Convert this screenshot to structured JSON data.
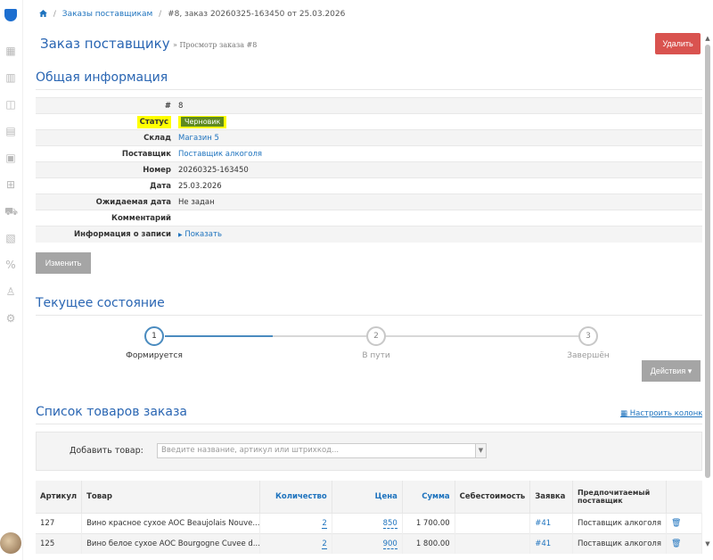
{
  "breadcrumb": {
    "parent": "Заказы поставщикам",
    "current": "#8, заказ 20260325-163450 от 25.03.2026"
  },
  "header": {
    "title": "Заказ поставщику",
    "subtitle": "» Просмотр заказа #8",
    "delete_label": "Удалить"
  },
  "general": {
    "title": "Общая информация",
    "rows": [
      {
        "label": "#",
        "value": "8"
      },
      {
        "label": "Статус",
        "value": "Черновик"
      },
      {
        "label": "Склад",
        "value": "Магазин 5"
      },
      {
        "label": "Поставщик",
        "value": "Поставщик алкоголя"
      },
      {
        "label": "Номер",
        "value": "20260325-163450"
      },
      {
        "label": "Дата",
        "value": "25.03.2026"
      },
      {
        "label": "Ожидаемая дата",
        "value": "Не задан"
      },
      {
        "label": "Комментарий",
        "value": ""
      },
      {
        "label": "Информация о записи",
        "value": "Показать"
      }
    ],
    "edit_label": "Изменить"
  },
  "state": {
    "title": "Текущее состояние",
    "steps": [
      {
        "num": "1",
        "label": "Формируется"
      },
      {
        "num": "2",
        "label": "В пути"
      },
      {
        "num": "3",
        "label": "Завершён"
      }
    ],
    "actions_label": "Действия ▾"
  },
  "items": {
    "title": "Список товаров заказа",
    "configure_label": "Настроить колонки",
    "add_label": "Добавить товар:",
    "add_placeholder": "Введите название, артикул или штрихкод...",
    "columns": [
      "Артикул",
      "Товар",
      "Количество",
      "Цена",
      "Сумма",
      "Себестоимость",
      "Заявка",
      "Предпочитаемый поставщик"
    ],
    "rows": [
      {
        "sku": "127",
        "name": "Вино красное сухое AOC Beaujolais Nouve...",
        "qty": "2",
        "price": "850",
        "sum": "1 700.00",
        "cost": "",
        "request": "#41",
        "supplier": "Поставщик алкоголя"
      },
      {
        "sku": "125",
        "name": "Вино белое сухое AOC Bourgogne Cuvee d...",
        "qty": "2",
        "price": "900",
        "sum": "1 800.00",
        "cost": "",
        "request": "#41",
        "supplier": "Поставщик алкоголя"
      }
    ]
  },
  "colors": {
    "accent": "#2a66b3",
    "danger": "#d9534f",
    "status_badge": "#5e8a1e",
    "highlight": "#ffff00"
  },
  "progress": {
    "current_step": 1,
    "total_steps": 3
  }
}
